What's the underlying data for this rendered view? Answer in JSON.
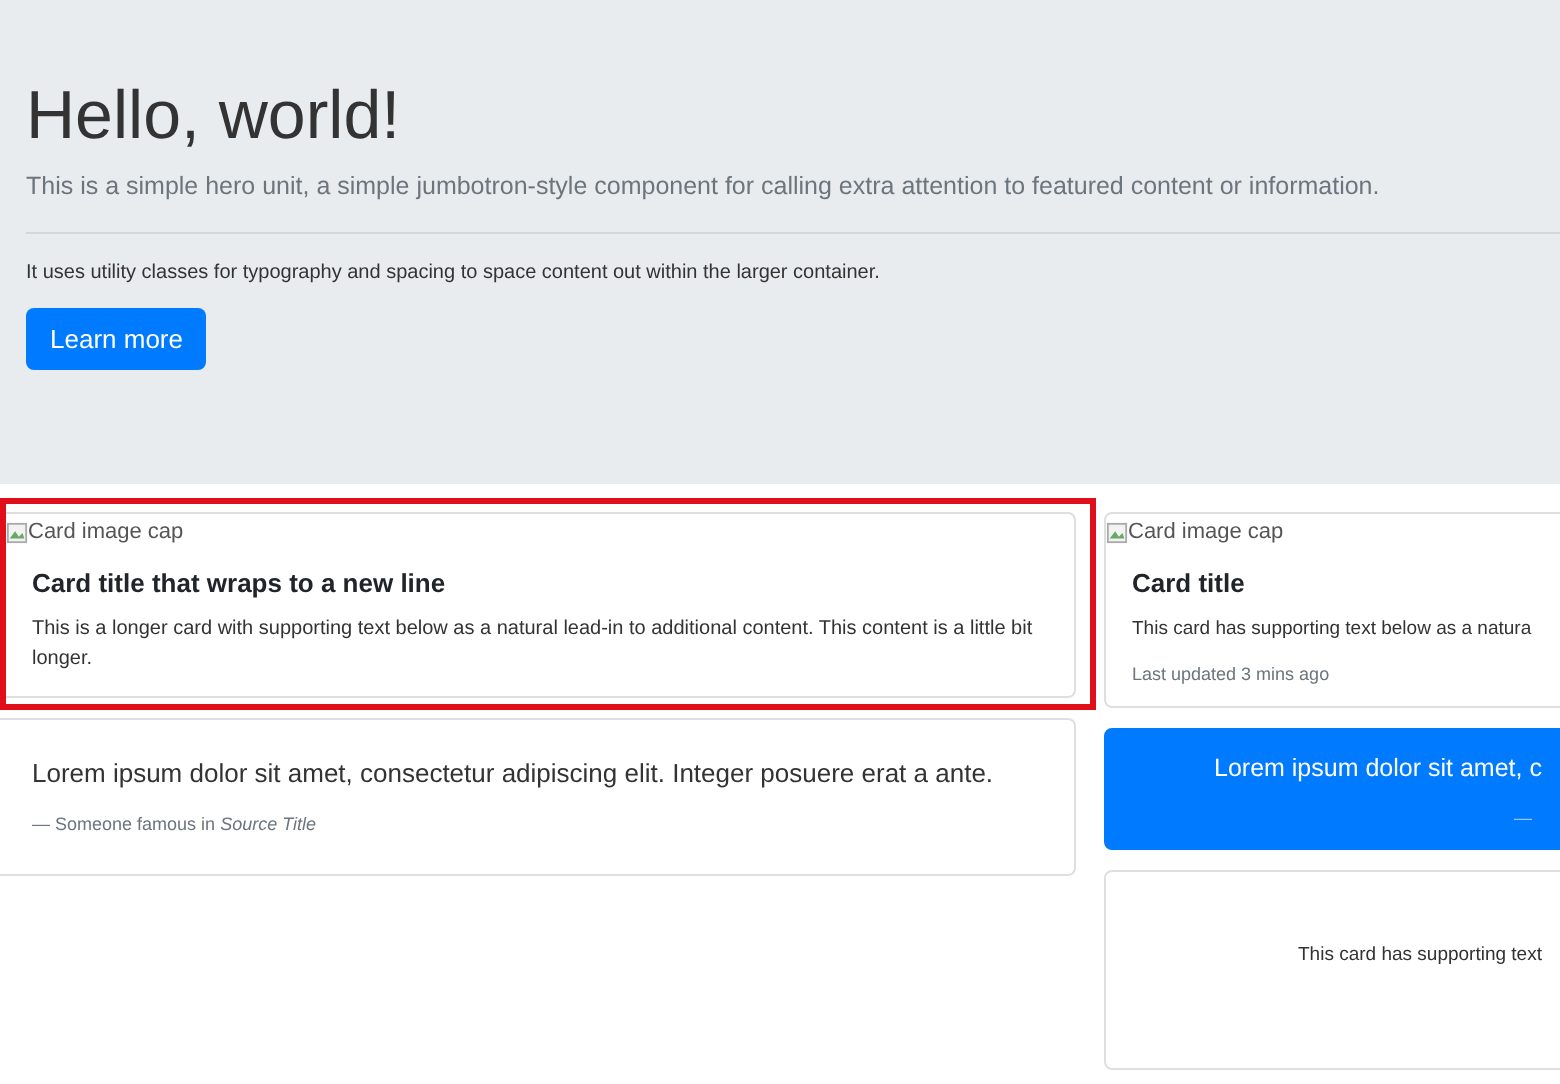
{
  "jumbotron": {
    "heading": "Hello, world!",
    "lead": "This is a simple hero unit, a simple jumbotron-style component for calling extra attention to featured content or information.",
    "text": "It uses utility classes for typography and spacing to space content out within the larger container.",
    "button": "Learn more"
  },
  "columns": [
    {
      "cards": [
        {
          "kind": "image",
          "highlighted": true,
          "image_alt": "Card image cap",
          "title": "Card title that wraps to a new line",
          "text": "This is a longer card with supporting text below as a natural lead-in to additional content. This content is a little bit longer."
        },
        {
          "kind": "quote",
          "highlighted": false,
          "quote": "Lorem ipsum dolor sit amet, consectetur adipiscing elit. Integer posuere erat a ante.",
          "footer": "— Someone famous in *Source Title*"
        }
      ]
    },
    {
      "cards": [
        {
          "kind": "image",
          "highlighted": false,
          "image_alt": "Card image cap",
          "title": "Card title",
          "text": "This card has supporting text below as a natura",
          "muted": "Last updated 3 mins ago"
        },
        {
          "kind": "primary-quote",
          "highlighted": false,
          "quote": "Lorem ipsum dolor sit amet, c",
          "footer": "—"
        },
        {
          "kind": "plain",
          "highlighted": false,
          "text": "This card has supporting text"
        }
      ]
    }
  ]
}
